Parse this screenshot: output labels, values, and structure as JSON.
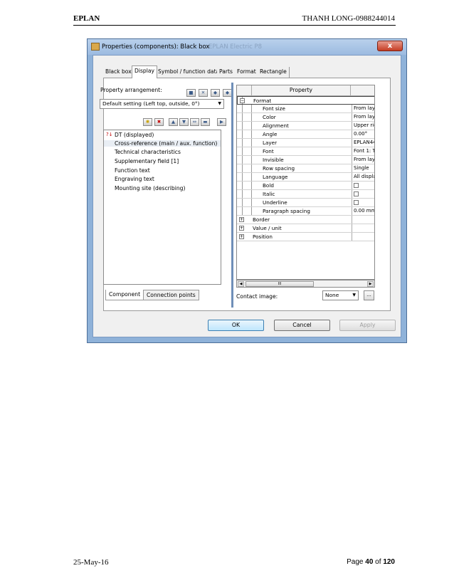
{
  "page_header": {
    "left": "EPLAN",
    "right": "THANH LONG-0988244014"
  },
  "page_footer": {
    "date": "25-May-16",
    "page_prefix": "Page ",
    "page_num": "40",
    "page_of": " of ",
    "page_total": "120"
  },
  "dialog": {
    "title": "Properties (components): Black box",
    "ghost_title": "EPLAN Electric P8",
    "close_glyph": "x",
    "tabs": [
      "Black box",
      "Display",
      "Symbol / function data",
      "Parts",
      "Format",
      "Rectangle"
    ],
    "active_tab": "Display",
    "property_arrangement_label": "Property arrangement:",
    "arrangement_value": "Default setting (Left top, outside, 0°)",
    "left_items": [
      "DT (displayed)",
      "Cross-reference (main / aux. function)",
      "Technical characteristics",
      "Supplementary field [1]",
      "Function text",
      "Engraving text",
      "Mounting site (describing)"
    ],
    "bottom_tabs": [
      "Component",
      "Connection points"
    ],
    "grid_header": "Property",
    "grid_rows": [
      {
        "name": "Format",
        "value": ""
      },
      {
        "name": "Font size",
        "value": "From lay"
      },
      {
        "name": "Color",
        "value": "From lay"
      },
      {
        "name": "Alignment",
        "value": "Upper rig"
      },
      {
        "name": "Angle",
        "value": "0.00°"
      },
      {
        "name": "Layer",
        "value": "EPLAN44"
      },
      {
        "name": "Font",
        "value": "Font 1: T"
      },
      {
        "name": "Invisible",
        "value": "From lay"
      },
      {
        "name": "Row spacing",
        "value": "Single"
      },
      {
        "name": "Language",
        "value": "All displa"
      },
      {
        "name": "Bold",
        "value": ""
      },
      {
        "name": "Italic",
        "value": ""
      },
      {
        "name": "Underline",
        "value": ""
      },
      {
        "name": "Paragraph spacing",
        "value": "0.00 mm"
      },
      {
        "name": "Border",
        "value": ""
      },
      {
        "name": "Value / unit",
        "value": ""
      },
      {
        "name": "Position",
        "value": ""
      }
    ],
    "scroll_grip": "III",
    "contact_image_label": "Contact image:",
    "contact_image_value": "None",
    "browse_label": "...",
    "ok_label": "OK",
    "cancel_label": "Cancel",
    "apply_label": "Apply"
  }
}
